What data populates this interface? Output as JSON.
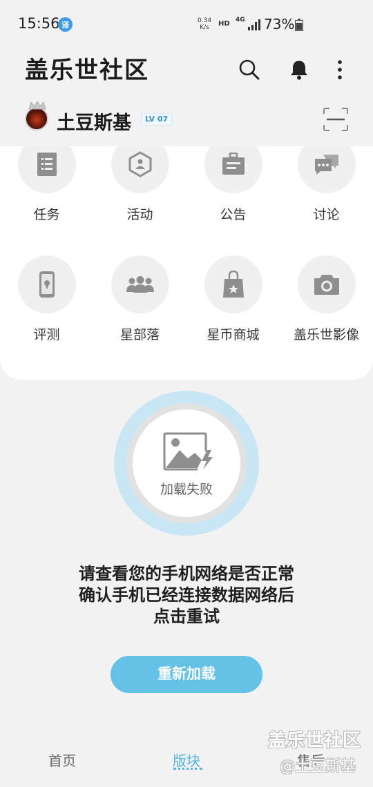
{
  "status_bar": {
    "time": "15:56",
    "translate_badge": "译",
    "net_speed_value": "0.34",
    "net_speed_unit": "K/s",
    "hd": "HD",
    "net_type": "4G",
    "battery": "73%"
  },
  "header": {
    "title": "盖乐世社区"
  },
  "user": {
    "name": "土豆斯基",
    "level": "LV 07"
  },
  "grid": {
    "items": [
      {
        "label": "任务",
        "icon": "task-list-icon"
      },
      {
        "label": "活动",
        "icon": "activity-hexagon-icon"
      },
      {
        "label": "公告",
        "icon": "announcement-icon"
      },
      {
        "label": "讨论",
        "icon": "discussion-icon"
      },
      {
        "label": "评测",
        "icon": "phone-review-icon"
      },
      {
        "label": "星部落",
        "icon": "group-people-icon"
      },
      {
        "label": "星币商城",
        "icon": "shopping-bag-icon"
      },
      {
        "label": "盖乐世影像",
        "icon": "camera-icon"
      }
    ]
  },
  "error": {
    "load_failed": "加载失败",
    "line1": "请查看您的手机网络是否正常",
    "line2": "确认手机已经连接数据网络后",
    "line3": "点击重试",
    "retry_label": "重新加载"
  },
  "bottom_nav": {
    "home": "首页",
    "board": "版块",
    "service": "售后"
  },
  "watermark": {
    "title": "盖乐世社区",
    "user": "@土豆斯基"
  },
  "colors": {
    "accent": "#50b4e4",
    "button": "#63c2e6",
    "ring": "#c9e6f5"
  }
}
